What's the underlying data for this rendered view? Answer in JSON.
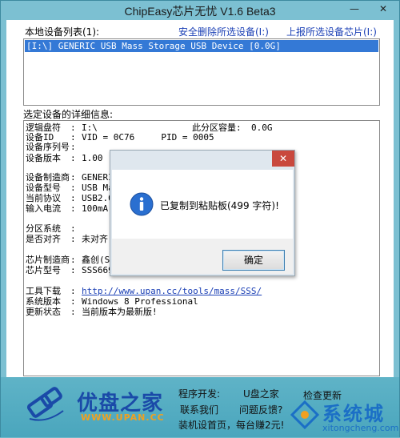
{
  "window": {
    "title": "ChipEasy芯片无忧 V1.6 Beta3",
    "minimize_glyph": "—",
    "close_glyph": "✕"
  },
  "device_list": {
    "label": "本地设备列表(1):",
    "safe_remove_link": "安全删除所选设备(I:)",
    "report_link": "上报所选设备芯片(I:)",
    "items": [
      "[I:\\] GENERIC USB Mass Storage USB Device [0.0G]"
    ]
  },
  "details": {
    "label": "选定设备的详细信息:",
    "rows": [
      {
        "k": "逻辑盘符",
        "v": "I:\\",
        "extra_k": "此分区容量:",
        "extra_v": "0.0G"
      },
      {
        "k": "设备ID",
        "v": "VID = 0C76     PID = 0005"
      },
      {
        "k": "设备序列号",
        "v": ""
      },
      {
        "k": "设备版本",
        "v": "1.00"
      },
      {
        "k": "设备制造商",
        "v": "GENERI"
      },
      {
        "k": "设备型号",
        "v": "USB Ma"
      },
      {
        "k": "当前协议",
        "v": "USB2.0"
      },
      {
        "k": "输入电流",
        "v": "100mA"
      },
      {
        "k": "分区系统",
        "v": ""
      },
      {
        "k": "是否对齐",
        "v": "未对齐"
      },
      {
        "k": "芯片制造商",
        "v": "鑫创(S"
      },
      {
        "k": "芯片型号",
        "v": "SSS669"
      },
      {
        "k": "工具下载",
        "v": "http://www.upan.cc/tools/mass/SSS/"
      },
      {
        "k": "系统版本",
        "v": "Windows 8 Professional"
      },
      {
        "k": "更新状态",
        "v": "当前版本为最新版!"
      }
    ]
  },
  "dialog": {
    "close_glyph": "✕",
    "message": "已复制到粘贴板(499 字符)!",
    "ok_label": "确定"
  },
  "footer": {
    "logo_text": "优盘之家",
    "logo_url": "WWW.UPAN.CC",
    "dev_label": "程序开发:",
    "dev_value": "U盘之家",
    "check_update": "检查更新",
    "contact": "联系我们",
    "feedback": "问题反馈?",
    "homepage": "装机设首页，每台赚2元!"
  },
  "watermark": {
    "text": "系统城",
    "url": "xitongcheng.com"
  }
}
